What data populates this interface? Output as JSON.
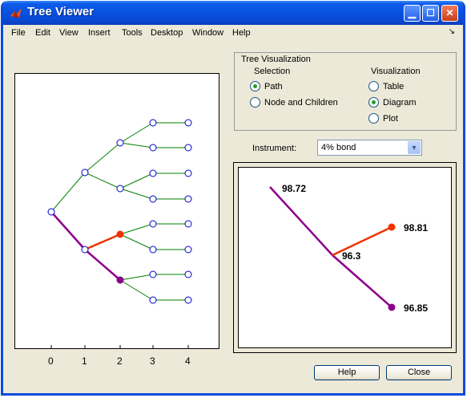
{
  "window": {
    "title": "Tree Viewer"
  },
  "menu": [
    "File",
    "Edit",
    "View",
    "Insert",
    "Tools",
    "Desktop",
    "Window",
    "Help"
  ],
  "tree_plot": {
    "x_ticks": [
      "0",
      "1",
      "2",
      "3",
      "4"
    ],
    "path_color": "#8b008b",
    "selected_color": "#ee3300",
    "branch_color": "#008000",
    "node_color": "#0000cc"
  },
  "tree_visualization": {
    "group_label": "Tree Visualization",
    "selection_label": "Selection",
    "visualization_label": "Visualization",
    "selection_options": [
      {
        "label": "Path",
        "selected": true
      },
      {
        "label": "Node and Children",
        "selected": false
      }
    ],
    "visualization_options": [
      {
        "label": "Table",
        "selected": false
      },
      {
        "label": "Diagram",
        "selected": true
      },
      {
        "label": "Plot",
        "selected": false
      }
    ]
  },
  "instrument": {
    "label": "Instrument:",
    "value": "4% bond"
  },
  "detail": {
    "top_value": "98.72",
    "mid_value": "96.3",
    "up_value": "98.81",
    "down_value": "96.85"
  },
  "buttons": {
    "help": "Help",
    "close": "Close"
  }
}
